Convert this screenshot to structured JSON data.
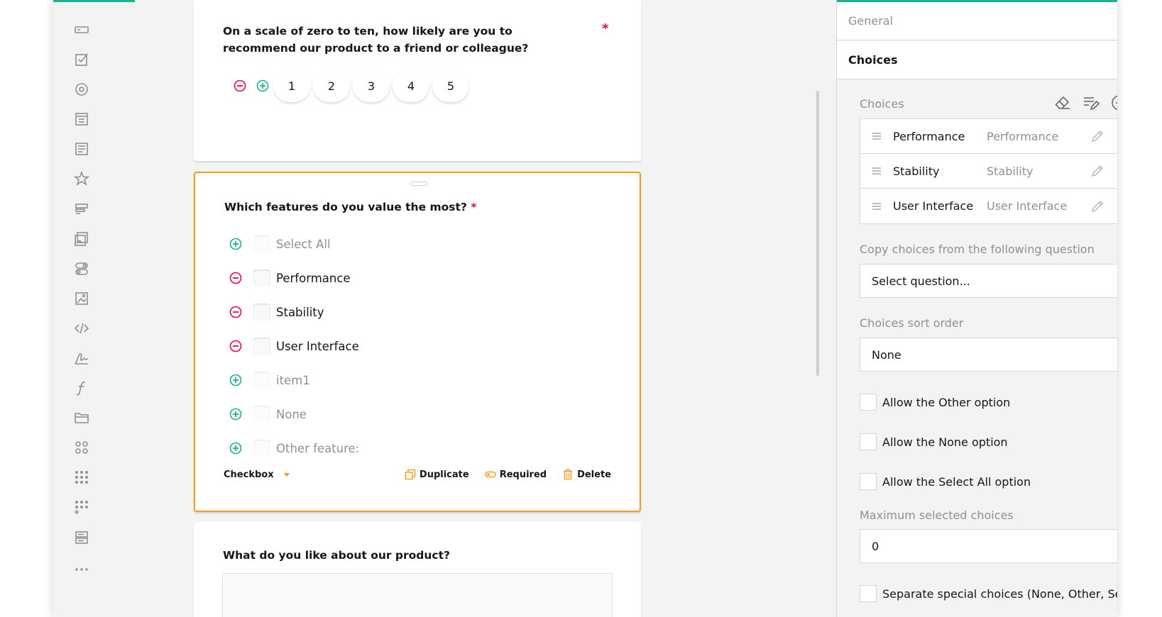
{
  "toolbox": {
    "items": [
      "single-line-input",
      "checkboxes",
      "radio-button-group",
      "dropdown",
      "comment",
      "rating-scale",
      "ranking",
      "image-picker",
      "boolean",
      "image",
      "html",
      "signature-pad",
      "expression",
      "file-upload",
      "multi-select-matrix",
      "multiple-textboxes",
      "dynamic-matrix",
      "panel",
      "more"
    ]
  },
  "q1": {
    "title": "On a scale of zero to ten, how likely are you to recommend our product to a friend or colleague?",
    "required_mark": "*",
    "rates": [
      "1",
      "2",
      "3",
      "4",
      "5"
    ]
  },
  "q2": {
    "title": "Which features do you value the most?",
    "required_mark": "*",
    "choices": [
      {
        "label": "Select All",
        "state": "add"
      },
      {
        "label": "Performance",
        "state": "remove"
      },
      {
        "label": "Stability",
        "state": "remove"
      },
      {
        "label": "User Interface",
        "state": "remove"
      },
      {
        "label": "item1",
        "state": "add"
      },
      {
        "label": "None",
        "state": "add"
      },
      {
        "label": "Other feature:",
        "state": "add"
      }
    ],
    "footer": {
      "type": "Checkbox",
      "duplicate": "Duplicate",
      "required": "Required",
      "delete": "Delete"
    }
  },
  "q3": {
    "title": "What do you like about our product?"
  },
  "panel": {
    "general_label": "General",
    "choices_label": "Choices",
    "choices_section_label": "Choices",
    "choices": [
      {
        "value": "Performance",
        "text": "Performance"
      },
      {
        "value": "Stability",
        "text": "Stability"
      },
      {
        "value": "User Interface",
        "text": "User Interface"
      }
    ],
    "copy_label": "Copy choices from the following question",
    "copy_placeholder": "Select question...",
    "sort_label": "Choices sort order",
    "sort_value": "None",
    "allow_other": "Allow the Other option",
    "allow_none": "Allow the None option",
    "allow_select_all": "Allow the Select All option",
    "max_label": "Maximum selected choices",
    "max_value": "0",
    "separate_special": "Separate special choices (None, Other, Select All)"
  },
  "colors": {
    "accent": "#19b394",
    "selected_border": "#ff9814",
    "required": "#e50a3e",
    "remove": "#e50a3e",
    "add": "#19b394"
  }
}
